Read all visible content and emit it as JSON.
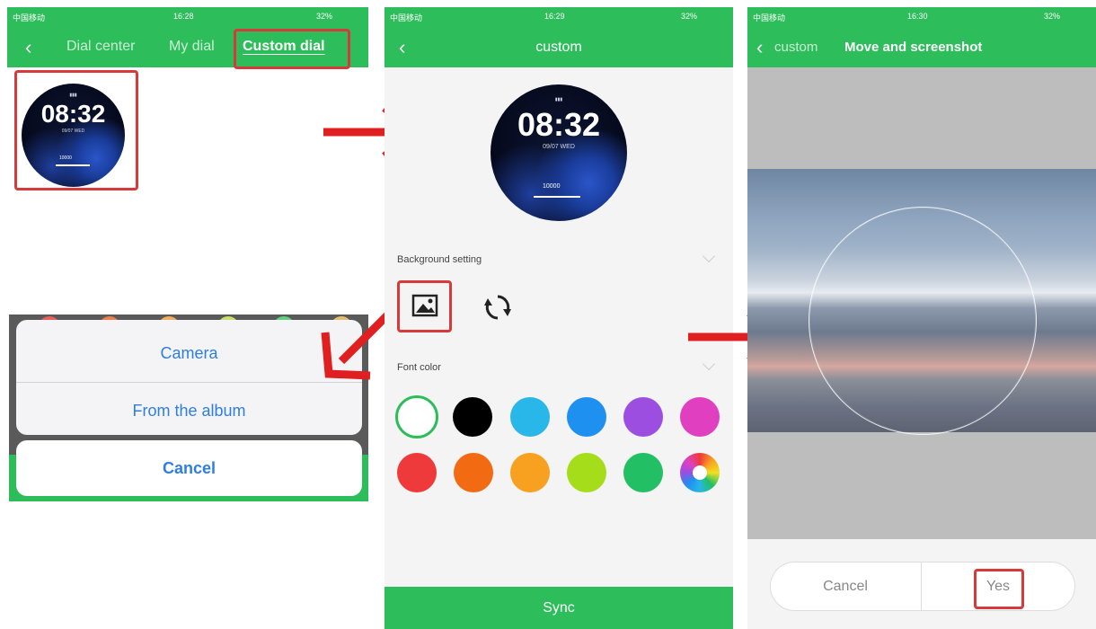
{
  "status_bar": {
    "carrier": "中国移动",
    "time_1": "16:28",
    "time_2": "16:29",
    "time_3": "16:30",
    "battery": "32%"
  },
  "dial_screen": {
    "tabs": [
      "Dial center",
      "My dial",
      "Custom dial"
    ],
    "active_tab": "Custom dial"
  },
  "watch_face": {
    "time": "08:32",
    "date": "09/07 WED",
    "steps": "10000"
  },
  "action_sheet": {
    "option_camera": "Camera",
    "option_album": "From the album",
    "cancel": "Cancel"
  },
  "custom_screen": {
    "title": "custom",
    "background_setting_label": "Background setting",
    "font_color_label": "Font color",
    "sync_label": "Sync",
    "font_colors": [
      "#ffffff",
      "#000000",
      "#29b6e8",
      "#1e90f0",
      "#9b4ee0",
      "#e040c0",
      "#ee3a3a",
      "#f26a12",
      "#f8a020",
      "#a6dd1a",
      "#22bf64",
      "multicolor"
    ],
    "selected_color": "#ffffff"
  },
  "crop_screen": {
    "back_label": "custom",
    "title": "Move and screenshot",
    "cancel": "Cancel",
    "confirm": "Yes"
  },
  "colors": {
    "accent_green": "#2dbd5a",
    "highlight_red": "#d63a3a",
    "ios_blue": "#2e7ee0"
  }
}
